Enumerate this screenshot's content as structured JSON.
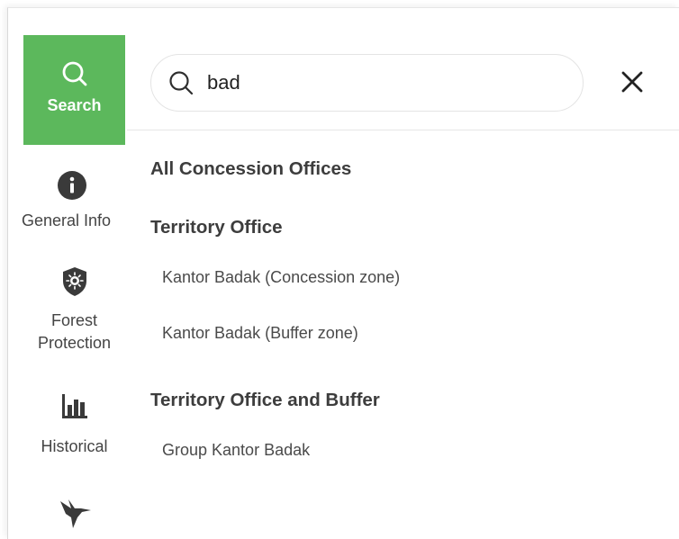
{
  "sidebar": {
    "search": {
      "label": "Search",
      "icon": "search-icon"
    },
    "general_info": {
      "label": "General Info",
      "icon": "info-icon"
    },
    "forest_protection": {
      "label_line1": "Forest",
      "label_line2": "Protection",
      "icon": "shield-icon"
    },
    "historical": {
      "label": "Historical",
      "icon": "bar-chart-icon"
    },
    "wildlife": {
      "icon": "hummingbird-icon"
    }
  },
  "search": {
    "value": "bad"
  },
  "results": {
    "all_offices": "All Concession Offices",
    "territory_office": {
      "heading": "Territory Office",
      "items": [
        "Kantor Badak (Concession zone)",
        "Kantor Badak (Buffer zone)"
      ]
    },
    "territory_office_buffer": {
      "heading": "Territory Office and Buffer",
      "items": [
        "Group Kantor Badak"
      ]
    }
  },
  "colors": {
    "accent": "#5cb85c",
    "text": "#3f3f3f"
  }
}
